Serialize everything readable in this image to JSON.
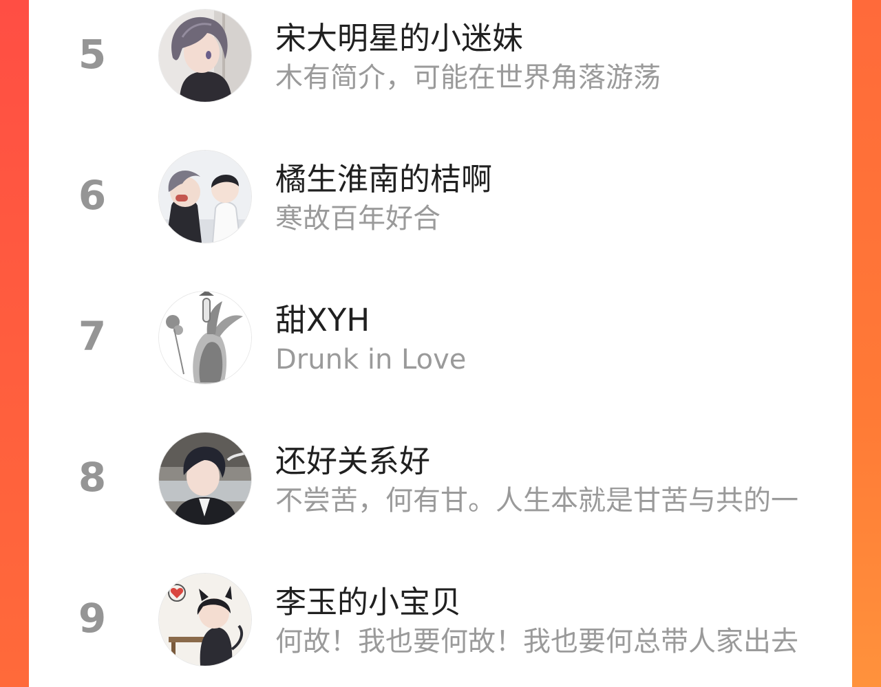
{
  "ranking": {
    "items": [
      {
        "rank": "5",
        "name": "宋大明星的小迷妹",
        "bio": "木有简介，可能在世界角落游荡",
        "avatar_icon": "anime-boy-gray-hair-avatar-icon"
      },
      {
        "rank": "6",
        "name": "橘生淮南的桔啊",
        "bio": "寒故百年好合",
        "avatar_icon": "anime-couple-avatar-icon"
      },
      {
        "rank": "7",
        "name": "甜XYH",
        "bio": "Drunk in Love",
        "avatar_icon": "ink-rabbit-sketch-avatar-icon"
      },
      {
        "rank": "8",
        "name": "还好关系好",
        "bio": "不尝苦，何有甘。人生本就是甘苦与共的一",
        "avatar_icon": "anime-man-suit-avatar-icon"
      },
      {
        "rank": "9",
        "name": "李玉的小宝贝",
        "bio": "何故！我也要何故！我也要何总带人家出去",
        "avatar_icon": "chibi-cat-boy-avatar-icon"
      }
    ]
  },
  "colors": {
    "background_left": "#ff4e44",
    "background_right": "#ff7a36",
    "panel": "#ffffff",
    "rank_text": "#959595",
    "name_text": "#202020",
    "bio_text": "#9a9a9a"
  }
}
